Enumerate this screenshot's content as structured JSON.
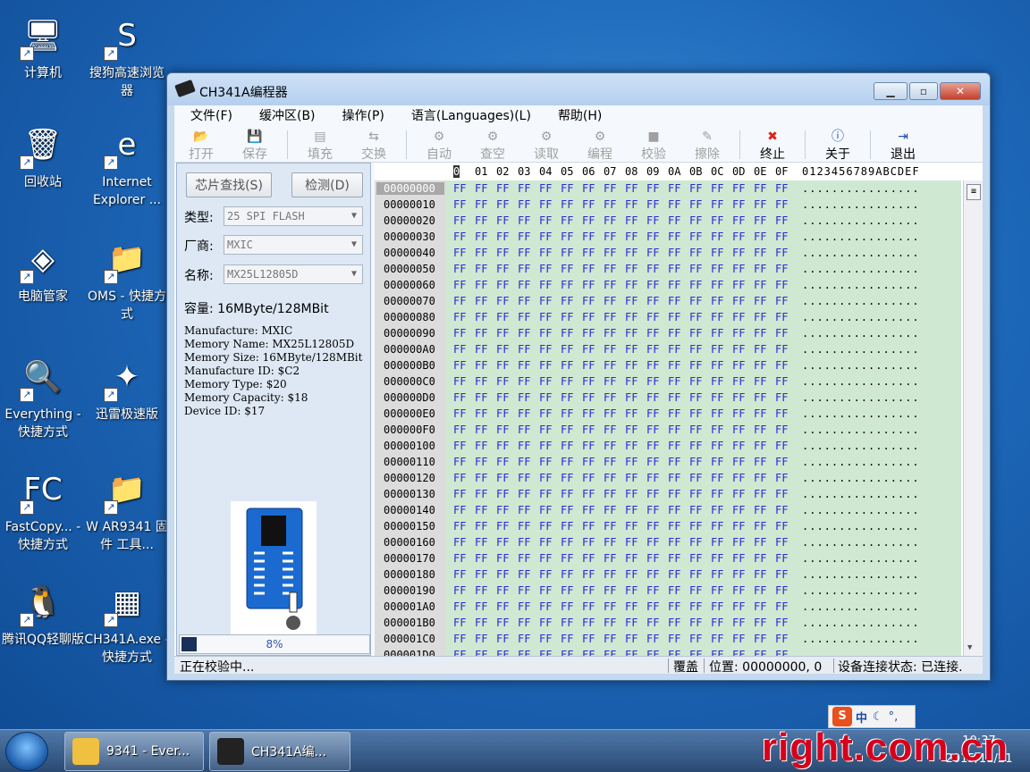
{
  "desktop": {
    "icons": [
      {
        "label": "计算机",
        "icon": "computer-icon"
      },
      {
        "label": "搜狗高速浏览器",
        "icon": "sogou-browser-icon"
      },
      {
        "label": "回收站",
        "icon": "recycle-bin-icon"
      },
      {
        "label": "Internet Explorer  ...",
        "icon": "ie-icon"
      },
      {
        "label": "电脑管家",
        "icon": "pc-manager-icon"
      },
      {
        "label": "OMS - 快捷方式",
        "icon": "folder-icon"
      },
      {
        "label": "Everything - 快捷方式",
        "icon": "everything-icon"
      },
      {
        "label": "迅雷极速版",
        "icon": "thunder-icon"
      },
      {
        "label": "FastCopy... - 快捷方式",
        "icon": "fastcopy-icon"
      },
      {
        "label": "W AR9341 固件 工具...",
        "icon": "folder-icon"
      },
      {
        "label": "腾讯QQ轻聊版",
        "icon": "qq-icon"
      },
      {
        "label": "CH341A.exe - 快捷方式",
        "icon": "chip-icon"
      }
    ]
  },
  "window": {
    "title": "CH341A编程器",
    "menu": [
      "文件(F)",
      "缓冲区(B)",
      "操作(P)",
      "语言(Languages)(L)",
      "帮助(H)"
    ],
    "toolbar": [
      {
        "label": "打开",
        "enabled": false,
        "icon": "open-icon"
      },
      {
        "label": "保存",
        "enabled": false,
        "icon": "save-icon"
      },
      {
        "label": "填充",
        "enabled": false,
        "icon": "fill-icon"
      },
      {
        "label": "交换",
        "enabled": false,
        "icon": "swap-icon"
      },
      {
        "label": "自动",
        "enabled": false,
        "icon": "auto-icon"
      },
      {
        "label": "查空",
        "enabled": false,
        "icon": "blank-check-icon"
      },
      {
        "label": "读取",
        "enabled": false,
        "icon": "read-icon"
      },
      {
        "label": "编程",
        "enabled": false,
        "icon": "program-icon"
      },
      {
        "label": "校验",
        "enabled": false,
        "icon": "verify-icon"
      },
      {
        "label": "擦除",
        "enabled": false,
        "icon": "erase-icon"
      },
      {
        "label": "终止",
        "enabled": true,
        "icon": "stop-icon"
      },
      {
        "label": "关于",
        "enabled": true,
        "icon": "info-icon"
      },
      {
        "label": "退出",
        "enabled": true,
        "icon": "exit-icon"
      }
    ],
    "left_panel": {
      "find_chip_button": "芯片查找(S)",
      "detect_button": "检测(D)",
      "type_label": "类型:",
      "type_value": "25 SPI FLASH",
      "vendor_label": "厂商:",
      "vendor_value": "MXIC",
      "name_label": "名称:",
      "name_value": "MX25L12805D",
      "capacity": "容量: 16MByte/128MBit",
      "info_lines": [
        "Manufacture: MXIC",
        "Memory Name: MX25L12805D",
        "Memory Size: 16MByte/128MBit",
        "Manufacture ID: $C2",
        "Memory Type: $20",
        "Memory Capacity: $18",
        "Device ID: $17"
      ],
      "progress_percent": 8,
      "progress_text": "8%"
    },
    "hex": {
      "header_bytes": [
        "0",
        "01",
        "02",
        "03",
        "04",
        "05",
        "06",
        "07",
        "08",
        "09",
        "0A",
        "0B",
        "0C",
        "0D",
        "0E",
        "0F"
      ],
      "header_ascii": "0123456789ABCDEF",
      "addresses": [
        "00000000",
        "00000010",
        "00000020",
        "00000030",
        "00000040",
        "00000050",
        "00000060",
        "00000070",
        "00000080",
        "00000090",
        "000000A0",
        "000000B0",
        "000000C0",
        "000000D0",
        "000000E0",
        "000000F0",
        "00000100",
        "00000110",
        "00000120",
        "00000130",
        "00000140",
        "00000150",
        "00000160",
        "00000170",
        "00000180",
        "00000190",
        "000001A0",
        "000001B0",
        "000001C0",
        "000001D0"
      ],
      "byte_value": "FF",
      "ascii_row": "................"
    },
    "status": {
      "message": "正在校验中...",
      "mode": "覆盖",
      "position": "位置: 00000000, 0",
      "connection": "设备连接状态: 已连接."
    }
  },
  "taskbar": {
    "tasks": [
      {
        "label": "9341 - Ever...",
        "icon": "everything-icon"
      },
      {
        "label": "CH341A编...",
        "icon": "chip-icon"
      }
    ],
    "ime": {
      "label": "中",
      "icon": "sogou-ime-icon"
    },
    "clock_time": "10:37",
    "clock_date": "2015/11/21"
  },
  "watermark": "right.com.cn",
  "colors": {
    "hex_bytes": "#2a2ad8",
    "hex_data_bg": "#cfe8d2",
    "stop_icon": "#d9251d",
    "watermark": "#d6001c"
  }
}
